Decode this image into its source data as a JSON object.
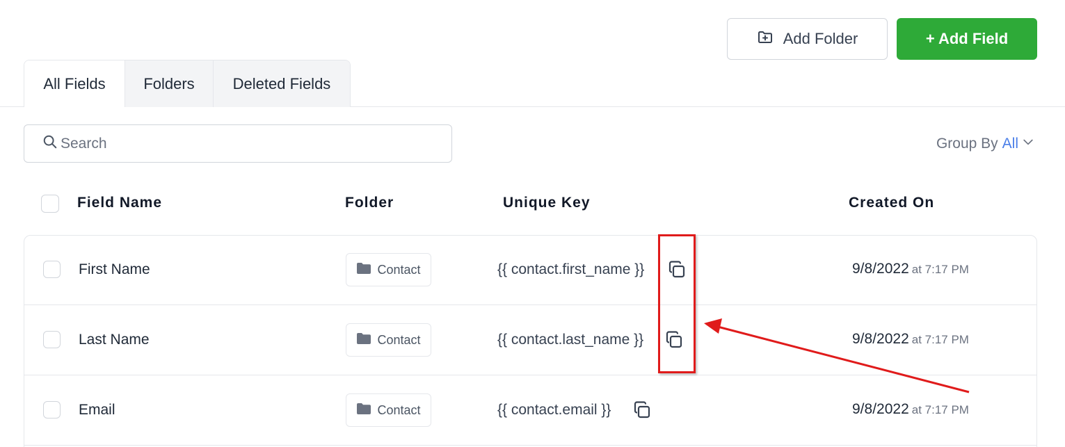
{
  "header": {
    "add_folder_label": "Add Folder",
    "add_field_label": "+ Add Field"
  },
  "tabs": [
    {
      "label": "All Fields",
      "active": true
    },
    {
      "label": "Folders",
      "active": false
    },
    {
      "label": "Deleted Fields",
      "active": false
    }
  ],
  "search": {
    "placeholder": "Search",
    "value": ""
  },
  "group_by": {
    "label": "Group By",
    "value": "All"
  },
  "table": {
    "columns": [
      "Field Name",
      "Folder",
      "Unique Key",
      "Created On"
    ],
    "rows": [
      {
        "name": "First Name",
        "folder": "Contact",
        "unique_key": "{{ contact.first_name }}",
        "date": "9/8/2022",
        "time": "at 7:17 PM"
      },
      {
        "name": "Last Name",
        "folder": "Contact",
        "unique_key": "{{ contact.last_name }}",
        "date": "9/8/2022",
        "time": "at 7:17 PM"
      },
      {
        "name": "Email",
        "folder": "Contact",
        "unique_key": "{{ contact.email }}",
        "date": "9/8/2022",
        "time": "at 7:17 PM"
      }
    ]
  },
  "colors": {
    "primary_button": "#2eaa38",
    "link_accent": "#4a7ee8",
    "annotation": "#e01b1b"
  },
  "icons": [
    "folder-plus-icon",
    "search-icon",
    "chevron-down-icon",
    "folder-icon",
    "copy-icon"
  ]
}
